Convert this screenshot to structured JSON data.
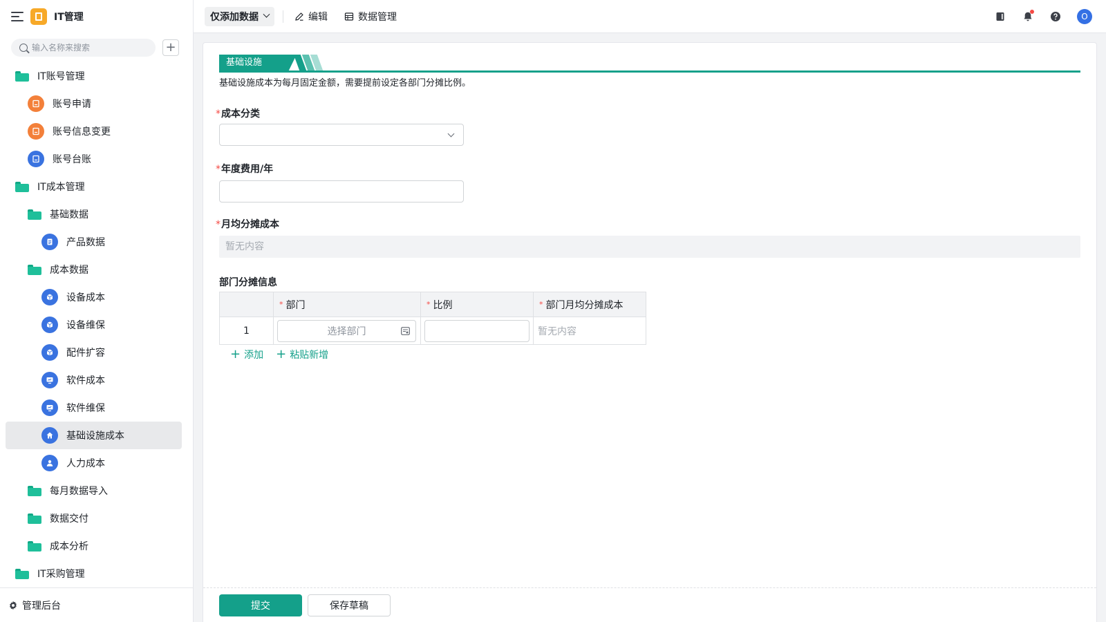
{
  "app": {
    "name": "IT管理"
  },
  "sidebar": {
    "search_placeholder": "输入名称来搜索",
    "items": [
      {
        "label": "IT账号管理"
      },
      {
        "label": "账号申请"
      },
      {
        "label": "账号信息变更"
      },
      {
        "label": "账号台账"
      },
      {
        "label": "IT成本管理"
      },
      {
        "label": "基础数据"
      },
      {
        "label": "产品数据"
      },
      {
        "label": "成本数据"
      },
      {
        "label": "设备成本"
      },
      {
        "label": "设备维保"
      },
      {
        "label": "配件扩容"
      },
      {
        "label": "软件成本"
      },
      {
        "label": "软件维保"
      },
      {
        "label": "基础设施成本"
      },
      {
        "label": "人力成本"
      },
      {
        "label": "每月数据导入"
      },
      {
        "label": "数据交付"
      },
      {
        "label": "成本分析"
      },
      {
        "label": "IT采购管理"
      }
    ],
    "footer_label": "管理后台"
  },
  "topbar": {
    "view_dropdown": "仅添加数据",
    "edit_label": "编辑",
    "data_manage_label": "数据管理",
    "avatar_letter": "O"
  },
  "form": {
    "section_tag": "基础设施",
    "section_desc": "基础设施成本为每月固定金额，需要提前设定各部门分摊比例。",
    "fields": {
      "cost_category": {
        "label": "成本分类",
        "value": ""
      },
      "annual_fee": {
        "label": "年度费用/年",
        "value": ""
      },
      "monthly_cost": {
        "label": "月均分摊成本",
        "value": "暂无内容"
      }
    },
    "subtable": {
      "title": "部门分摊信息",
      "headers": [
        "部门",
        "比例",
        "部门月均分摊成本"
      ],
      "rows": [
        {
          "index": "1",
          "dept_placeholder": "选择部门",
          "ratio": "",
          "monthly": "暂无内容"
        }
      ],
      "add_label": "添加",
      "paste_label": "粘贴新增"
    },
    "submit_label": "提交",
    "draft_label": "保存草稿"
  },
  "colors": {
    "accent": "#14a08a",
    "orange": "#f3803a",
    "blue": "#3a73e0",
    "folder": "#1fbf9a"
  }
}
